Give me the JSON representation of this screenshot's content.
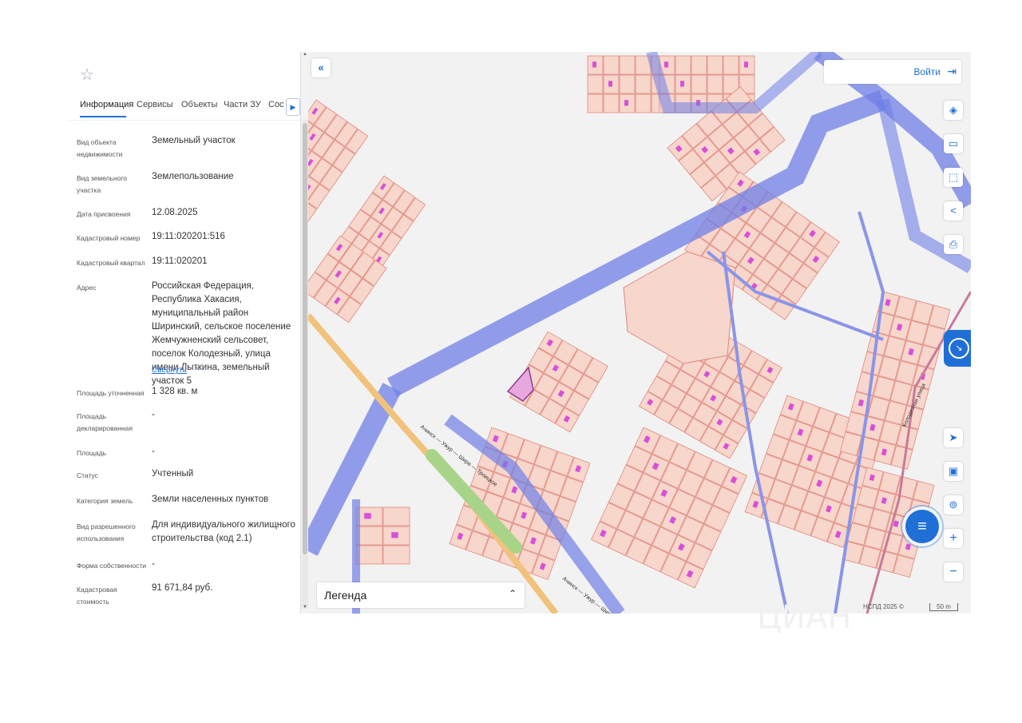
{
  "panel": {
    "tabs": [
      "Информация",
      "Сервисы",
      "Объекты",
      "Части ЗУ",
      "Состав"
    ],
    "collapse_label": "Свернуть",
    "rows": [
      {
        "label": "Вид объекта недвижимости",
        "value": "Земельный участок"
      },
      {
        "label": "Вид земельного участка",
        "value": "Землепользование"
      },
      {
        "label": "Дата присвоения",
        "value": "12.08.2025"
      },
      {
        "label": "Кадастровый номер",
        "value": "19:11:020201:516"
      },
      {
        "label": "Кадастровый квартал",
        "value": "19:11:020201"
      },
      {
        "label": "Адрес",
        "value": "Российская Федерация, Республика Хакасия, муниципальный район Ширинский, сельское поселение Жемчужненский сельсовет, поселок Колодезный, улица имени Лыткина, земельный участок 5"
      },
      {
        "label": "Площадь уточненная",
        "value": "1 328 кв. м"
      },
      {
        "label": "Площадь декларированная",
        "value": "-"
      },
      {
        "label": "Площадь",
        "value": "-"
      },
      {
        "label": "Статус",
        "value": "Учтенный"
      },
      {
        "label": "Категория земель",
        "value": "Земли населенных пунктов"
      },
      {
        "label": "Вид разрешенного использования",
        "value": "Для индивидуального жилищного строительства (код 2.1)"
      },
      {
        "label": "Форма собственности",
        "value": "-"
      },
      {
        "label": "Кадастровая стоимость",
        "value": "91 671,84 руб."
      }
    ]
  },
  "map": {
    "login_label": "Войти",
    "legend_label": "Легенда",
    "footer": "НСПД 2025 ©",
    "scale": "50 m",
    "road_labels": [
      "Ачинск — Ужур — Шира — Троицкое",
      "Ачинск — Ужур — Шира — Троицкое",
      "Ачинск — Ужур — Шира"
    ],
    "street_labels": [
      "Колодезная улица",
      "улица"
    ],
    "colors": {
      "parcel_fill": "#f7d6cc",
      "parcel_line": "#e0877a",
      "road_band": "#6f7fe6",
      "selected": "#c94fc9",
      "building": "#d84fd8",
      "accent": "#1f6fd6"
    }
  },
  "watermark": "ЦИАН"
}
